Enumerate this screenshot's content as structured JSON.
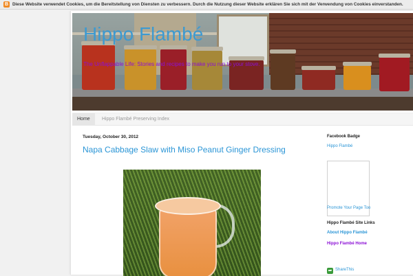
{
  "cookie_bar": {
    "icon": "blogger-icon",
    "text": "Diese Website verwendet Cookies, um die Bereitstellung von Diensten zu verbessern. Durch die Nutzung dieser Website erklären Sie sich mit der Verwendung von Cookies einverstanden."
  },
  "header": {
    "title": "Hippo Flambé",
    "description": "The Unflappable Life: Stories and recipes to make you run to your stove."
  },
  "tabs": [
    {
      "label": "Home"
    },
    {
      "label": "Hippo Flambé Preserving Index"
    }
  ],
  "post": {
    "date": "Tuesday, October 30, 2012",
    "title": "Napa Cabbage Slaw with Miso Peanut Ginger Dressing"
  },
  "sidebar": {
    "facebook_badge_heading": "Facebook Badge",
    "facebook_badge_name": "Hippo Flambé",
    "promote_link": "Promote Your Page Too",
    "site_links_heading": "Hippo Flambé Site Links",
    "about_link": "About Hippo Flambé",
    "home_link": "Hippo Flambé Home",
    "sharethis": "ShareThis"
  },
  "colors": {
    "title_blue": "#3d9ad1",
    "link_blue": "#2a95d6",
    "desc_purple": "#8b0fd6"
  }
}
